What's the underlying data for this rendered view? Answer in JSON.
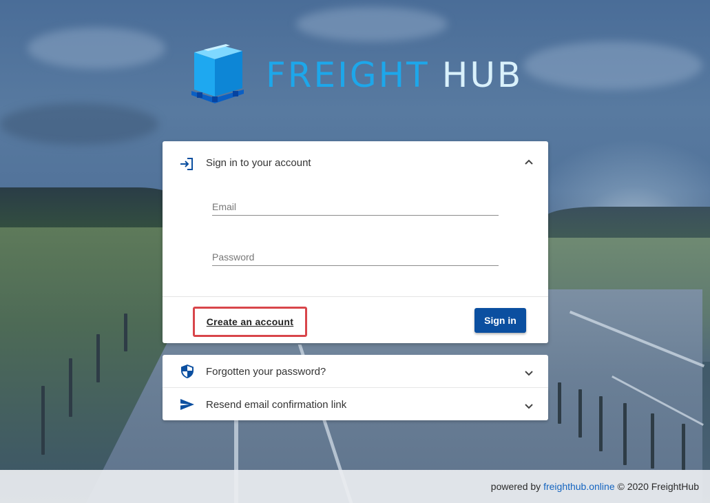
{
  "brand": {
    "name_part1": "FREIGHT",
    "name_part2": "HUB",
    "colors": {
      "part1": "#1da7ea",
      "part2": "#d9f1fb",
      "cube": "#1ea8f0"
    }
  },
  "signin_card": {
    "title": "Sign in to your account",
    "icon": "login-icon",
    "collapse_icon": "chevron-up-icon",
    "email_placeholder": "Email",
    "password_placeholder": "Password",
    "create_account_label": "Create an account",
    "signin_label": "Sign in",
    "accent": "#0b4fa0",
    "highlight_border": "#d8454a"
  },
  "panels": [
    {
      "label": "Forgotten your password?",
      "icon": "shield-icon",
      "expand_icon": "chevron-down-icon"
    },
    {
      "label": "Resend email confirmation link",
      "icon": "send-icon",
      "expand_icon": "chevron-down-icon"
    }
  ],
  "footer": {
    "prefix": "powered by",
    "link_text": "freighthub.online",
    "suffix": "© 2020 FreightHub"
  }
}
